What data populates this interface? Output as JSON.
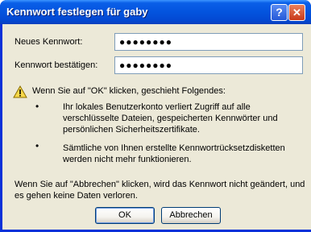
{
  "window": {
    "title": "Kennwort festlegen für gaby",
    "help_glyph": "?",
    "close_glyph": "✕"
  },
  "form": {
    "new_password_label": "Neues Kennwort:",
    "new_password_value": "●●●●●●●●",
    "confirm_password_label": "Kennwort bestätigen:",
    "confirm_password_value": "●●●●●●●●"
  },
  "warning": {
    "icon": "warning-triangle-icon",
    "intro": "Wenn Sie auf \"OK\" klicken, geschieht Folgendes:",
    "bullet_glyph": "•",
    "items": [
      "Ihr lokales Benutzerkonto verliert Zugriff auf alle verschlüsselte Dateien, gespeicherten Kennwörter und persönlichen Sicherheitszertifikate.",
      "Sämtliche von Ihnen erstellte Kennwortrücksetzdisketten werden nicht mehr funktionieren."
    ],
    "cancel_note": "Wenn Sie auf \"Abbrechen\" klicken, wird das Kennwort nicht geändert, und es gehen keine Daten verloren."
  },
  "buttons": {
    "ok": "OK",
    "cancel": "Abbrechen"
  },
  "colors": {
    "titlebar": "#0354de",
    "dialog_background": "#ece9d8",
    "field_border": "#7f9db9"
  }
}
